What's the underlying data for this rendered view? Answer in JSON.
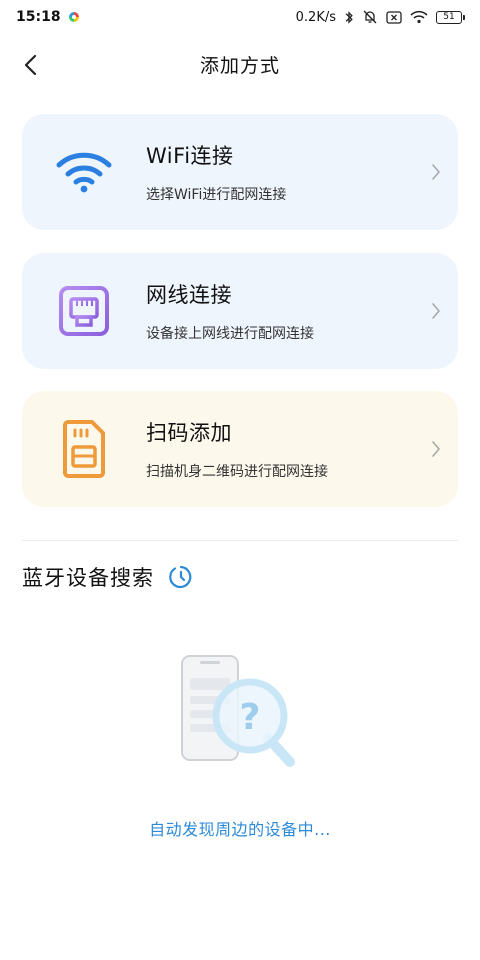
{
  "status_bar": {
    "time": "15:18",
    "net_speed": "0.2K/s",
    "battery": "51"
  },
  "header": {
    "title": "添加方式"
  },
  "options": [
    {
      "title": "WiFi连接",
      "subtitle": "选择WiFi进行配网连接",
      "icon": "wifi-icon",
      "color": "#2a7fe0"
    },
    {
      "title": "网线连接",
      "subtitle": "设备接上网线进行配网连接",
      "icon": "ethernet-port-icon",
      "color": "#9a6ee0"
    },
    {
      "title": "扫码添加",
      "subtitle": "扫描机身二维码进行配网连接",
      "icon": "sim-card-icon",
      "color": "#ef9a3a"
    }
  ],
  "bluetooth": {
    "title": "蓝牙设备搜索",
    "searching_text": "自动发现周边的设备中..."
  },
  "colors": {
    "accent": "#2d8ad8",
    "card_blue_bg": "#eff5fd",
    "card_amber_bg": "#fdf8ec"
  }
}
